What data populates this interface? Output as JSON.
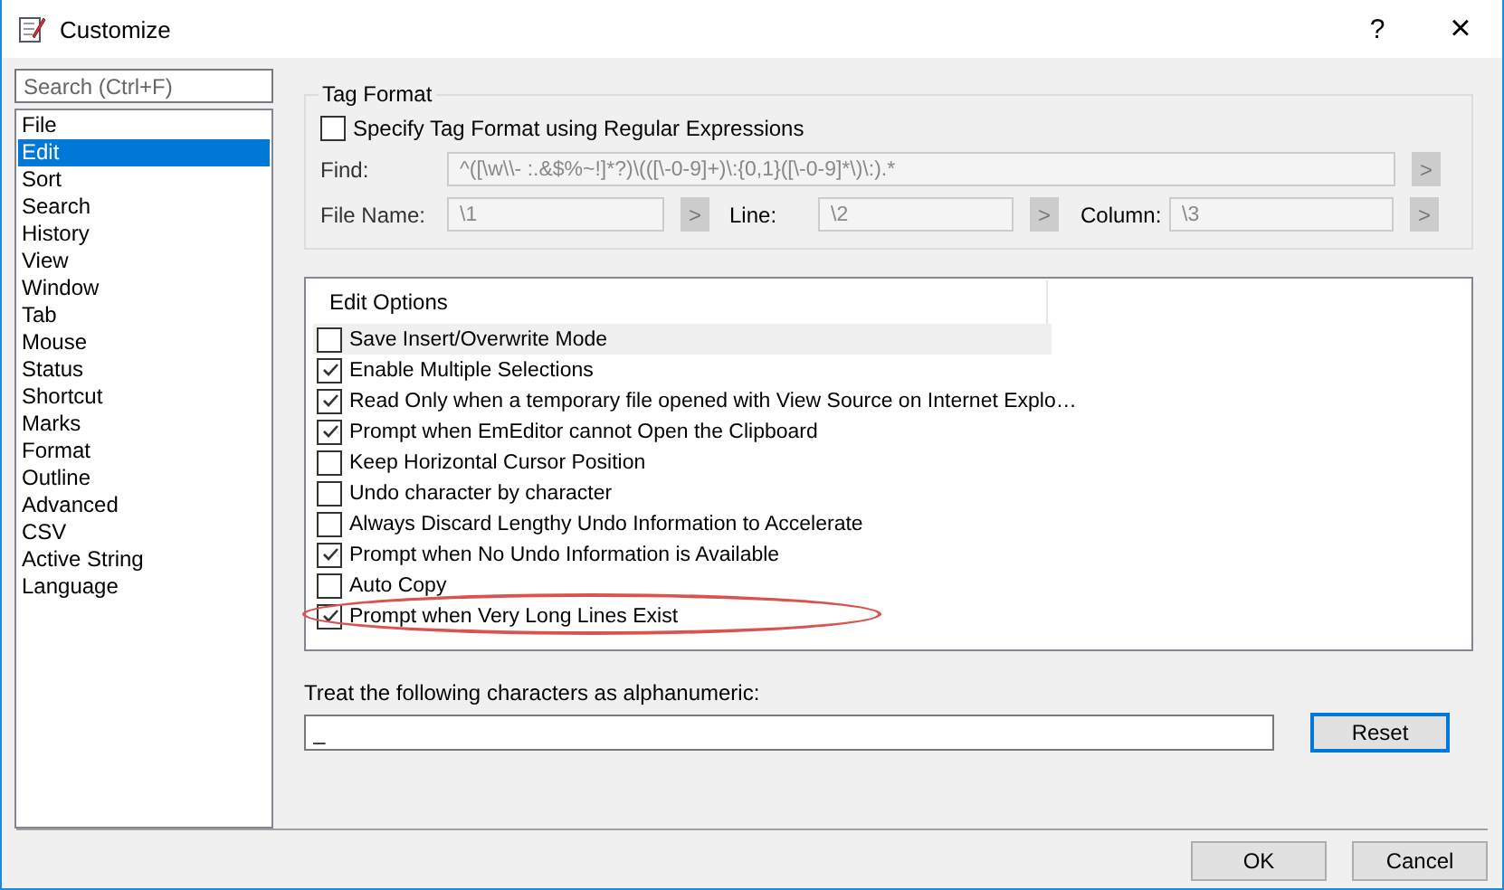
{
  "window": {
    "title": "Customize",
    "help": "?",
    "close": "×"
  },
  "sidebar": {
    "search": {
      "placeholder": "Search (Ctrl+F)"
    },
    "items": [
      {
        "label": "File",
        "selected": false
      },
      {
        "label": "Edit",
        "selected": true
      },
      {
        "label": "Sort",
        "selected": false
      },
      {
        "label": "Search",
        "selected": false
      },
      {
        "label": "History",
        "selected": false
      },
      {
        "label": "View",
        "selected": false
      },
      {
        "label": "Window",
        "selected": false
      },
      {
        "label": "Tab",
        "selected": false
      },
      {
        "label": "Mouse",
        "selected": false
      },
      {
        "label": "Status",
        "selected": false
      },
      {
        "label": "Shortcut",
        "selected": false
      },
      {
        "label": "Marks",
        "selected": false
      },
      {
        "label": "Format",
        "selected": false
      },
      {
        "label": "Outline",
        "selected": false
      },
      {
        "label": "Advanced",
        "selected": false
      },
      {
        "label": "CSV",
        "selected": false
      },
      {
        "label": "Active String",
        "selected": false
      },
      {
        "label": "Language",
        "selected": false
      }
    ]
  },
  "tag_format": {
    "title": "Tag Format",
    "checkbox": {
      "label": "Specify Tag Format using Regular Expressions",
      "checked": false
    },
    "disabled": true,
    "find": {
      "label": "Find:",
      "value": "^([\\w\\\\- :.&$%~!]*?)\\(([\\-0-9]+)\\:{0,1}([\\-0-9]*\\)\\:).*",
      "button": ">"
    },
    "file_name": {
      "label": "File Name:",
      "value": "\\1",
      "button": ">"
    },
    "line": {
      "label": "Line:",
      "value": "\\2",
      "button": ">"
    },
    "column": {
      "label": "Column:",
      "value": "\\3",
      "button": ">"
    }
  },
  "edit_options": {
    "header": "Edit Options",
    "items": [
      {
        "label": "Save Insert/Overwrite Mode",
        "checked": false,
        "selected": true,
        "annotated": false
      },
      {
        "label": "Enable Multiple Selections",
        "checked": true,
        "selected": false,
        "annotated": false
      },
      {
        "label": "Read Only when a temporary file opened with View Source on Internet Explo…",
        "checked": true,
        "selected": false,
        "annotated": false
      },
      {
        "label": "Prompt when EmEditor cannot Open the Clipboard",
        "checked": true,
        "selected": false,
        "annotated": false
      },
      {
        "label": "Keep Horizontal Cursor Position",
        "checked": false,
        "selected": false,
        "annotated": false
      },
      {
        "label": "Undo character by character",
        "checked": false,
        "selected": false,
        "annotated": false
      },
      {
        "label": "Always Discard Lengthy Undo Information to Accelerate",
        "checked": false,
        "selected": false,
        "annotated": false
      },
      {
        "label": "Prompt when No Undo Information is Available",
        "checked": true,
        "selected": false,
        "annotated": false
      },
      {
        "label": "Auto Copy",
        "checked": false,
        "selected": false,
        "annotated": false
      },
      {
        "label": "Prompt when Very Long Lines Exist",
        "checked": true,
        "selected": false,
        "annotated": true
      }
    ]
  },
  "alphanumeric": {
    "label": "Treat the following characters as alphanumeric:",
    "value": "_",
    "button": "Reset"
  },
  "buttons": [
    "OK",
    "Cancel"
  ]
}
